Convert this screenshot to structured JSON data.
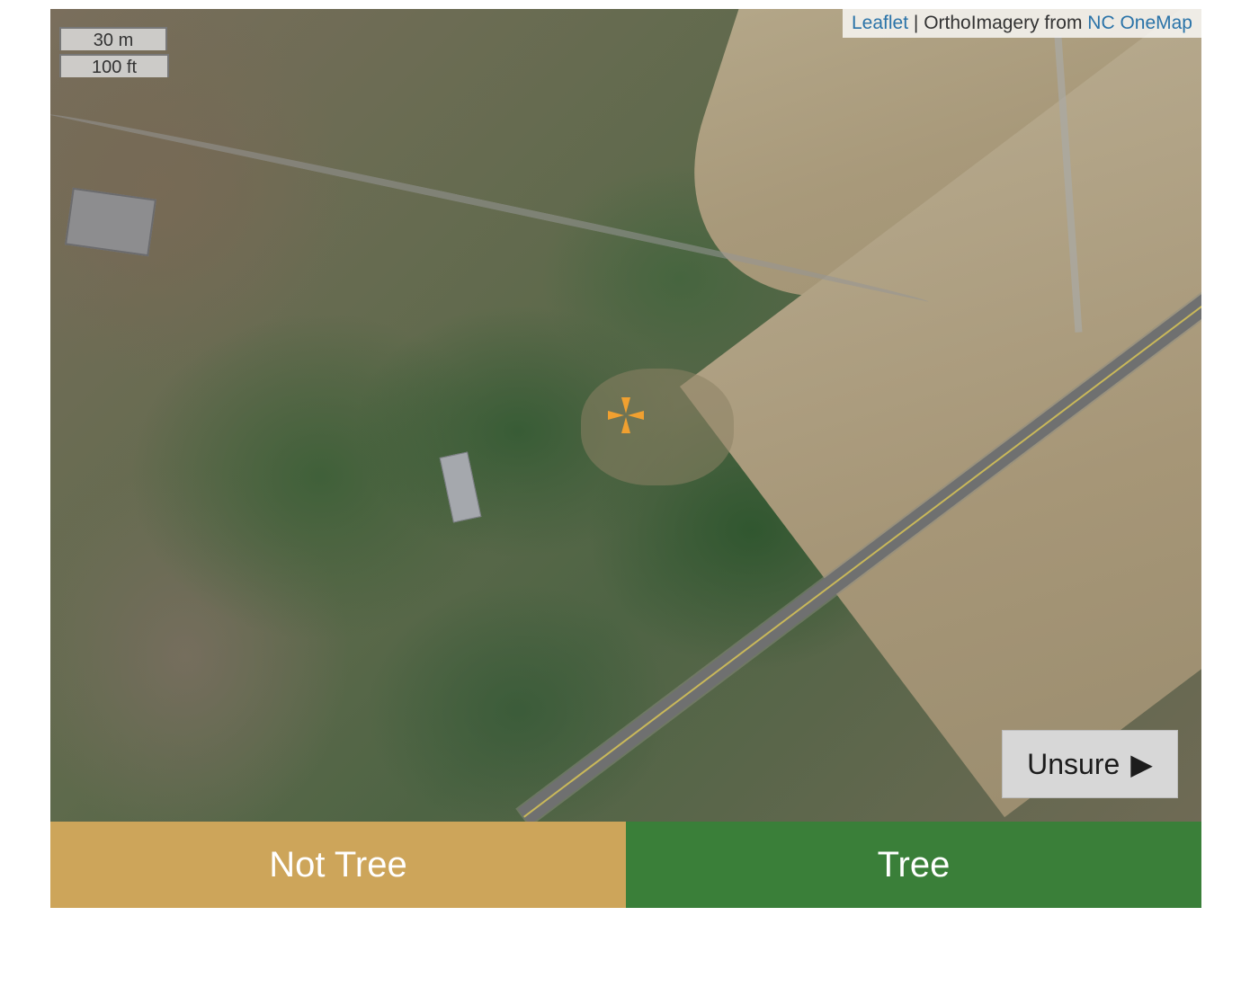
{
  "map": {
    "scale": {
      "metric": "30 m",
      "imperial": "100 ft"
    },
    "attribution": {
      "leaflet_link": "Leaflet",
      "separator": "|",
      "text": "OrthoImagery from",
      "source_link": "NC OneMap"
    },
    "marker_icon": "crosshair-target-icon",
    "marker_color": "#f0a030",
    "unsure_button": {
      "label": "Unsure",
      "icon": "play-arrow-icon",
      "glyph": "▶"
    }
  },
  "answers": {
    "not_tree": {
      "label": "Not Tree",
      "color": "#cda55a"
    },
    "tree": {
      "label": "Tree",
      "color": "#3a7f39"
    }
  }
}
